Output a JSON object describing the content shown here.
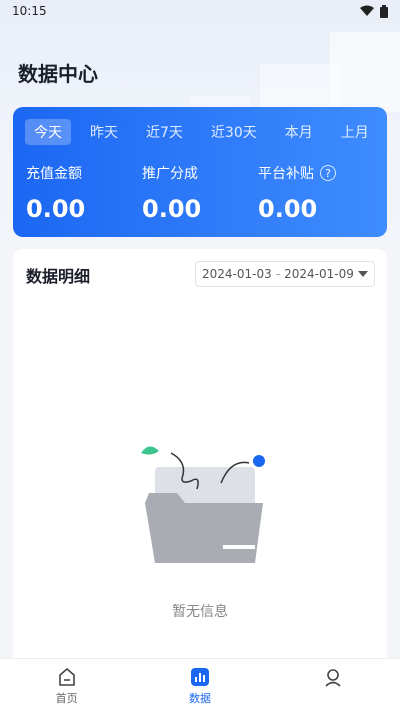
{
  "status": {
    "time": "10:15"
  },
  "page": {
    "title": "数据中心"
  },
  "tabs": [
    {
      "label": "今天",
      "active": true
    },
    {
      "label": "昨天",
      "active": false
    },
    {
      "label": "近7天",
      "active": false
    },
    {
      "label": "近30天",
      "active": false
    },
    {
      "label": "本月",
      "active": false
    },
    {
      "label": "上月",
      "active": false
    }
  ],
  "stats": [
    {
      "label": "充值金额",
      "value": "0.00"
    },
    {
      "label": "推广分成",
      "value": "0.00"
    },
    {
      "label": "平台补贴",
      "value": "0.00",
      "help": "?"
    }
  ],
  "detail": {
    "title": "数据明细",
    "date_start": "2024-01-03",
    "date_end": "2024-01-09",
    "date_sep": "-",
    "empty_text": "暂无信息"
  },
  "nav": [
    {
      "label": "首页",
      "icon": "home-icon"
    },
    {
      "label": "数据",
      "icon": "chart-icon",
      "active": true
    },
    {
      "label": "",
      "icon": "profile-icon"
    }
  ],
  "colors": {
    "primary": "#1c67f2",
    "accent_end": "#3f8cff",
    "background": "#f3f5f9"
  }
}
